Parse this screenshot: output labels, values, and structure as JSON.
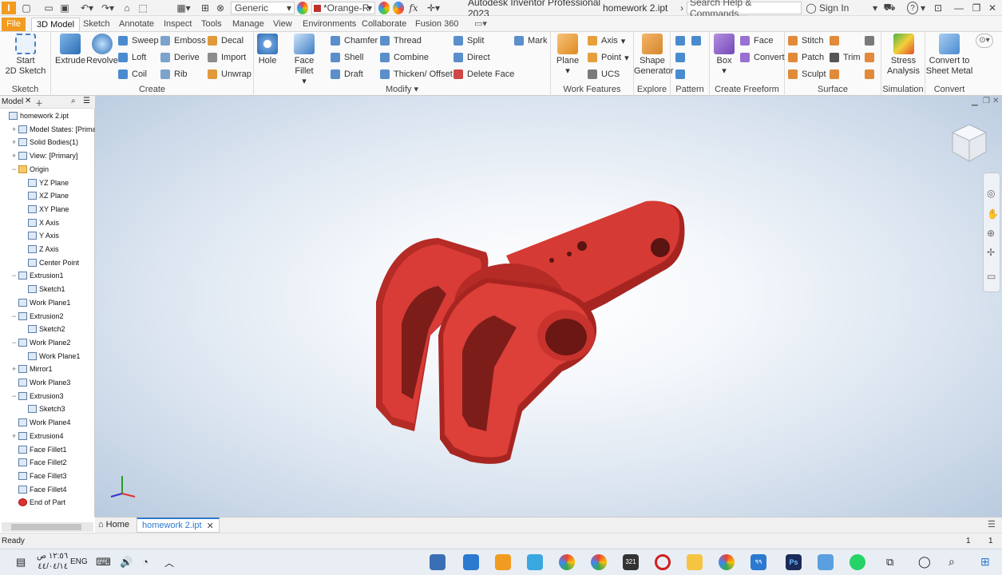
{
  "titlebar": {
    "app_letter": "I",
    "material": "Generic",
    "appearance": "*Orange-R",
    "fx": "fx",
    "app_title": "Autodesk Inventor Professional 2023",
    "doc_title": "homework 2.ipt",
    "search_placeholder": "Search Help & Commands...",
    "sign_in": "Sign In",
    "help": "?"
  },
  "tabs": [
    "File",
    "3D Model",
    "Sketch",
    "Annotate",
    "Inspect",
    "Tools",
    "Manage",
    "View",
    "Environments",
    "Collaborate",
    "Fusion 360"
  ],
  "ribbon": {
    "sketch": {
      "label": "Sketch",
      "start": "Start",
      "start2": "2D Sketch"
    },
    "create": {
      "label": "Create",
      "extrude": "Extrude",
      "revolve": "Revolve",
      "sweep": "Sweep",
      "loft": "Loft",
      "coil": "Coil",
      "emboss": "Emboss",
      "derive": "Derive",
      "rib": "Rib",
      "decal": "Decal",
      "import": "Import",
      "unwrap": "Unwrap"
    },
    "modify": {
      "label": "Modify",
      "hole": "Hole",
      "face_fillet": "Face Fillet",
      "chamfer": "Chamfer",
      "shell": "Shell",
      "draft": "Draft",
      "thread": "Thread",
      "combine": "Combine",
      "thicken": "Thicken/ Offset",
      "split": "Split",
      "direct": "Direct",
      "delete_face": "Delete Face",
      "mark": "Mark"
    },
    "work": {
      "label": "Work Features",
      "plane": "Plane",
      "axis": "Axis",
      "point": "Point",
      "ucs": "UCS"
    },
    "explore": {
      "label": "Explore",
      "shape": "Shape",
      "generator": "Generator"
    },
    "pattern": {
      "label": "Pattern"
    },
    "freeform": {
      "label": "Create Freeform",
      "box": "Box",
      "face": "Face",
      "convert": "Convert"
    },
    "surface": {
      "label": "Surface",
      "stitch": "Stitch",
      "patch": "Patch",
      "sculpt": "Sculpt",
      "trim": "Trim"
    },
    "simulation": {
      "label": "Simulation",
      "stress": "Stress",
      "analysis": "Analysis"
    },
    "convert": {
      "label": "Convert",
      "to": "Convert to",
      "sheet": "Sheet Metal"
    }
  },
  "browser": {
    "tab": "Model",
    "nodes": [
      {
        "label": "homework 2.ipt",
        "indent": 0,
        "exp": ""
      },
      {
        "label": "Model States: [Primary]",
        "indent": 1,
        "exp": "+"
      },
      {
        "label": "Solid Bodies(1)",
        "indent": 1,
        "exp": "+"
      },
      {
        "label": "View: [Primary]",
        "indent": 1,
        "exp": "+"
      },
      {
        "label": "Origin",
        "indent": 1,
        "exp": "−"
      },
      {
        "label": "YZ Plane",
        "indent": 2,
        "exp": ""
      },
      {
        "label": "XZ Plane",
        "indent": 2,
        "exp": ""
      },
      {
        "label": "XY Plane",
        "indent": 2,
        "exp": ""
      },
      {
        "label": "X Axis",
        "indent": 2,
        "exp": ""
      },
      {
        "label": "Y Axis",
        "indent": 2,
        "exp": ""
      },
      {
        "label": "Z Axis",
        "indent": 2,
        "exp": ""
      },
      {
        "label": "Center Point",
        "indent": 2,
        "exp": ""
      },
      {
        "label": "Extrusion1",
        "indent": 1,
        "exp": "−"
      },
      {
        "label": "Sketch1",
        "indent": 2,
        "exp": ""
      },
      {
        "label": "Work Plane1",
        "indent": 1,
        "exp": ""
      },
      {
        "label": "Extrusion2",
        "indent": 1,
        "exp": "−"
      },
      {
        "label": "Sketch2",
        "indent": 2,
        "exp": ""
      },
      {
        "label": "Work Plane2",
        "indent": 1,
        "exp": "−"
      },
      {
        "label": "Work Plane1",
        "indent": 2,
        "exp": ""
      },
      {
        "label": "Mirror1",
        "indent": 1,
        "exp": "+"
      },
      {
        "label": "Work Plane3",
        "indent": 1,
        "exp": ""
      },
      {
        "label": "Extrusion3",
        "indent": 1,
        "exp": "−"
      },
      {
        "label": "Sketch3",
        "indent": 2,
        "exp": ""
      },
      {
        "label": "Work Plane4",
        "indent": 1,
        "exp": ""
      },
      {
        "label": "Extrusion4",
        "indent": 1,
        "exp": "+"
      },
      {
        "label": "Face Fillet1",
        "indent": 1,
        "exp": ""
      },
      {
        "label": "Face Fillet2",
        "indent": 1,
        "exp": ""
      },
      {
        "label": "Face Fillet3",
        "indent": 1,
        "exp": ""
      },
      {
        "label": "Face Fillet4",
        "indent": 1,
        "exp": ""
      },
      {
        "label": "End of Part",
        "indent": 1,
        "exp": ""
      }
    ]
  },
  "doc_tabs": {
    "home": "Home",
    "doc": "homework 2.ipt"
  },
  "status": {
    "left": "Ready",
    "right1": "1",
    "right2": "1"
  },
  "taskbar": {
    "time": "١٢:٥٦ ص",
    "date": "٤٤/٠٤/١٤",
    "lang": "ENG",
    "badge": "٩٩",
    "cal": "321"
  },
  "colors": {
    "part": "#d93b36",
    "part_dark": "#a82420",
    "accent": "#f29b21"
  }
}
